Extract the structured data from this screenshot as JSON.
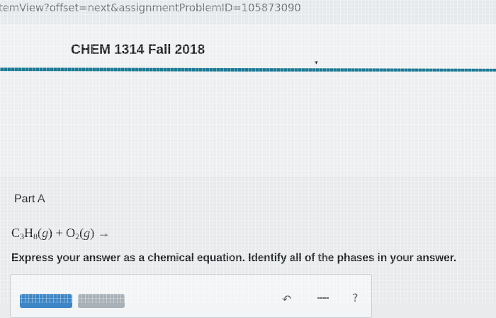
{
  "browser": {
    "url": "temView?offset=next&assignmentProblemID=105873090"
  },
  "course": {
    "title": "CHEM 1314 Fall 2018"
  },
  "question": {
    "part_label": "Part A",
    "reaction": {
      "reactant1": {
        "C": "C",
        "c_sub": "3",
        "H": "H",
        "h_sub": "8",
        "phase": "g"
      },
      "plus": "+",
      "reactant2": {
        "O": "O",
        "o_sub": "2",
        "phase": "g"
      },
      "arrow": "→"
    },
    "instructions": "Express your answer as a chemical equation. Identify all of the phases in your answer."
  },
  "toolbar": {
    "icons": [
      "undo-arrow-icon",
      "minus-icon",
      "help-icon"
    ]
  },
  "colors": {
    "accent_rule": "#1c7a95",
    "primary_button": "#3d86c6",
    "secondary_button": "#a9b1b8"
  }
}
